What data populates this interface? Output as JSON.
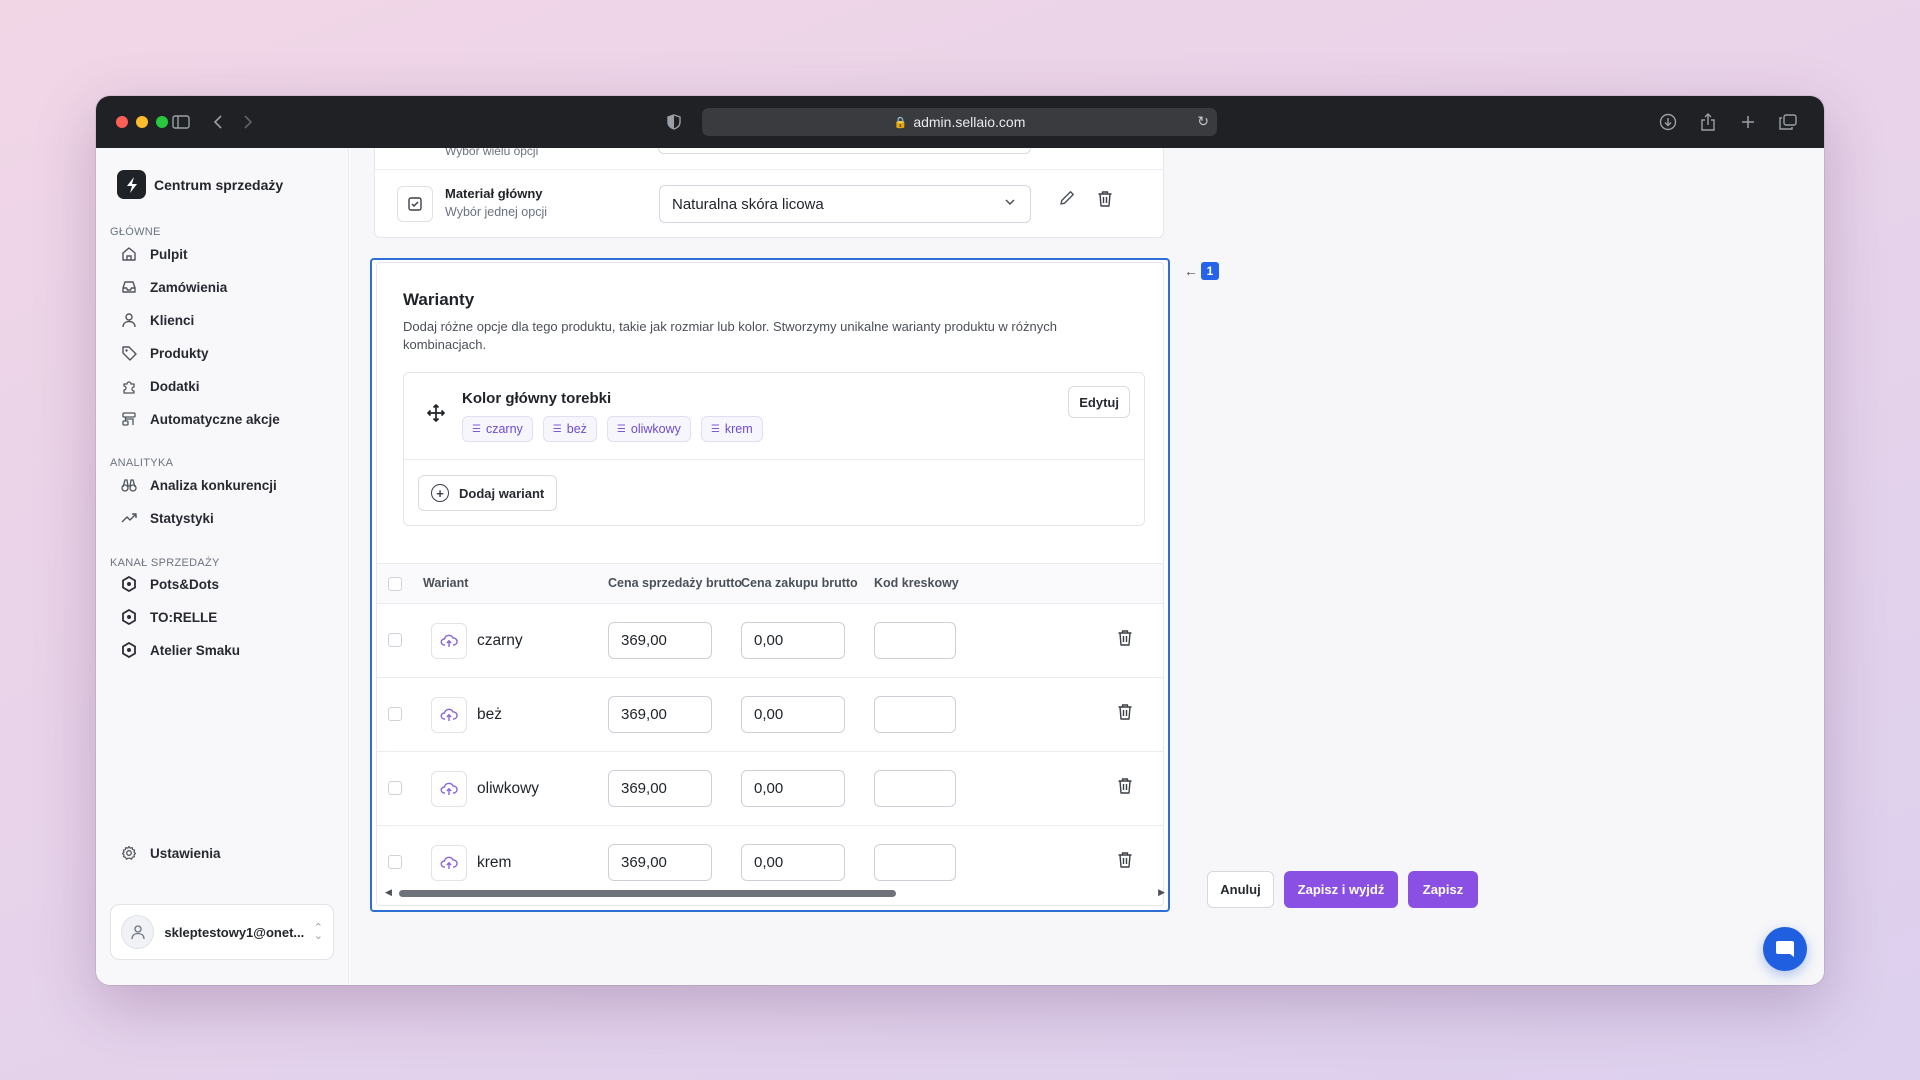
{
  "browser": {
    "url": "admin.sellaio.com"
  },
  "sidebar": {
    "brand": "Centrum sprzedaży",
    "sections": [
      {
        "label": "GŁÓWNE",
        "items": [
          "Pulpit",
          "Zamówienia",
          "Klienci",
          "Produkty",
          "Dodatki",
          "Automatyczne akcje"
        ]
      },
      {
        "label": "ANALITYKA",
        "items": [
          "Analiza konkurencji",
          "Statystyki"
        ]
      },
      {
        "label": "KANAŁ SPRZEDAŻY",
        "items": [
          "Pots&Dots",
          "TO:RELLE",
          "Atelier Smaku"
        ]
      }
    ],
    "settings": "Ustawienia",
    "user_email": "skleptestowy1@onet..."
  },
  "options": {
    "cut_text": "Wybór wielu opcji",
    "material_title": "Materiał główny",
    "material_sub": "Wybór jednej opcji",
    "material_value": "Naturalna skóra licowa"
  },
  "variants": {
    "title": "Warianty",
    "description": "Dodaj różne opcje dla tego produktu, takie jak rozmiar lub kolor. Stworzymy unikalne warianty produktu w różnych kombinacjach.",
    "group_name": "Kolor główny torebki",
    "chips": [
      "czarny",
      "beż",
      "oliwkowy",
      "krem"
    ],
    "edit_label": "Edytuj",
    "add_label": "Dodaj wariant",
    "table": {
      "headers": [
        "Wariant",
        "Cena sprzedaży brutto",
        "Cena zakupu brutto",
        "Kod kreskowy"
      ],
      "rows": [
        {
          "name": "czarny",
          "sale_price": "369,00",
          "purchase_price": "0,00",
          "barcode": ""
        },
        {
          "name": "beż",
          "sale_price": "369,00",
          "purchase_price": "0,00",
          "barcode": ""
        },
        {
          "name": "oliwkowy",
          "sale_price": "369,00",
          "purchase_price": "0,00",
          "barcode": ""
        },
        {
          "name": "krem",
          "sale_price": "369,00",
          "purchase_price": "0,00",
          "barcode": ""
        }
      ]
    }
  },
  "annotation": {
    "number": "1"
  },
  "footer": {
    "cancel": "Anuluj",
    "save_exit": "Zapisz i wyjdź",
    "save": "Zapisz"
  },
  "colors": {
    "accent": "#8a4fe3",
    "focus": "#2e6fd6",
    "chat": "#1f5fe0"
  }
}
